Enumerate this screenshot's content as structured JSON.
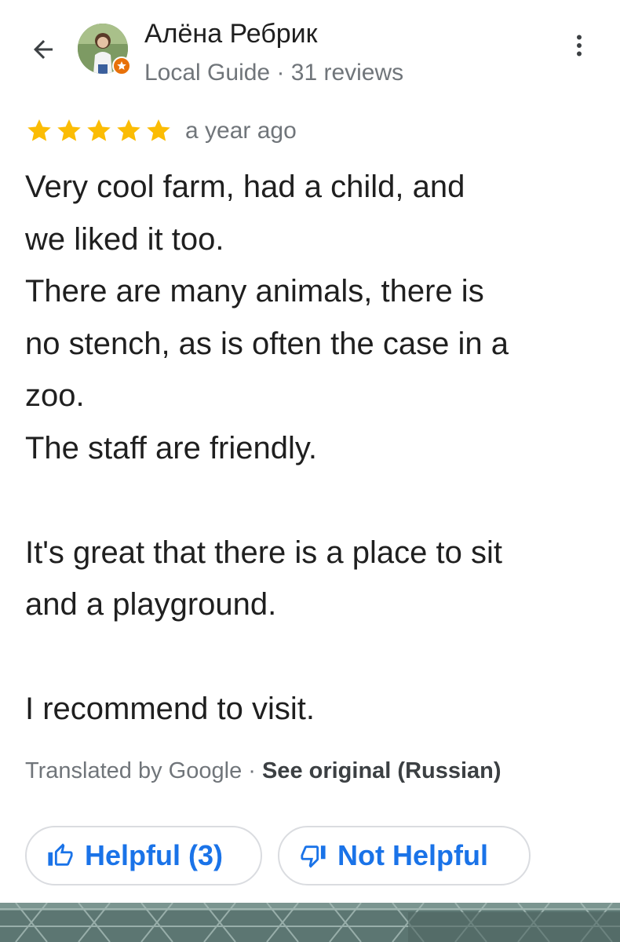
{
  "header": {
    "author_name": "Алёна Ребрик",
    "author_meta": "Local Guide · 31 reviews"
  },
  "review": {
    "rating": 5,
    "max_rating": 5,
    "date": "a year ago",
    "lines": [
      "Very cool farm, had a child, and",
      "we liked it too.",
      "There are many animals, there is",
      "no stench, as is often the case in a",
      "zoo.",
      "The staff are friendly.",
      "",
      "It's great that there is a place to sit",
      "and a playground.",
      "",
      "I recommend to visit."
    ]
  },
  "translation": {
    "by": "Translated by Google · ",
    "see_original": "See original (Russian)"
  },
  "actions": {
    "helpful_label": "Helpful (3)",
    "not_helpful_label": "Not Helpful"
  },
  "colors": {
    "star": "#fbbc04",
    "accent": "#1a73e8",
    "muted": "#70757a",
    "badge": "#e8710a"
  },
  "icons": [
    "back-arrow-icon",
    "local-guide-badge-icon",
    "more-vert-icon",
    "star-icon",
    "thumbs-up-icon",
    "thumbs-down-icon"
  ]
}
